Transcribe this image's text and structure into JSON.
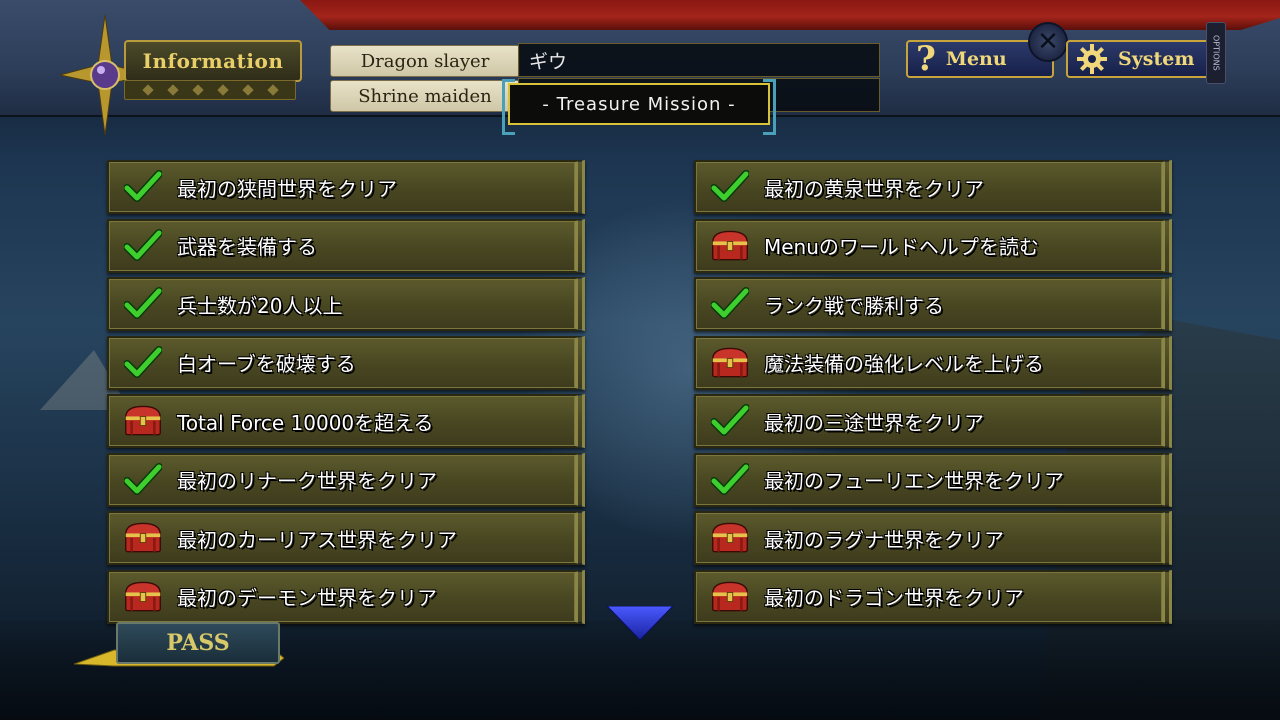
{
  "header": {
    "info_label": "Information",
    "role1_label": "Dragon slayer",
    "role1_value": "ギウ",
    "role2_label": "Shrine maiden",
    "role2_value": "",
    "menu_label": "Menu",
    "system_label": "System",
    "options_label": "OPTIONS",
    "mission_title": "- Treasure Mission -"
  },
  "missions_left": [
    {
      "label": "最初の狭間世界をクリア",
      "status": "done",
      "icon": "checkmark-icon"
    },
    {
      "label": "武器を装備する",
      "status": "done",
      "icon": "checkmark-icon"
    },
    {
      "label": "兵士数が20人以上",
      "status": "done",
      "icon": "checkmark-icon"
    },
    {
      "label": "白オーブを破壊する",
      "status": "done",
      "icon": "checkmark-icon"
    },
    {
      "label": "Total Force 10000を超える",
      "status": "pending",
      "icon": "treasure-chest-icon"
    },
    {
      "label": "最初のリナーク世界をクリア",
      "status": "done",
      "icon": "checkmark-icon"
    },
    {
      "label": "最初のカーリアス世界をクリア",
      "status": "pending",
      "icon": "treasure-chest-icon"
    },
    {
      "label": "最初のデーモン世界をクリア",
      "status": "pending",
      "icon": "treasure-chest-icon"
    }
  ],
  "missions_right": [
    {
      "label": "最初の黄泉世界をクリア",
      "status": "done",
      "icon": "checkmark-icon"
    },
    {
      "label": "Menuのワールドヘルプを読む",
      "status": "pending",
      "icon": "treasure-chest-icon"
    },
    {
      "label": "ランク戦で勝利する",
      "status": "done",
      "icon": "checkmark-icon"
    },
    {
      "label": "魔法装備の強化レベルを上げる",
      "status": "pending",
      "icon": "treasure-chest-icon"
    },
    {
      "label": "最初の三途世界をクリア",
      "status": "done",
      "icon": "checkmark-icon"
    },
    {
      "label": "最初のフューリエン世界をクリア",
      "status": "done",
      "icon": "checkmark-icon"
    },
    {
      "label": "最初のラグナ世界をクリア",
      "status": "pending",
      "icon": "treasure-chest-icon"
    },
    {
      "label": "最初のドラゴン世界をクリア",
      "status": "pending",
      "icon": "treasure-chest-icon"
    }
  ],
  "pass_label": "PASS",
  "colors": {
    "check": "#3ecf2e",
    "chest": "#b8281e",
    "row_bg": "#4a4822",
    "gold": "#d8c23a"
  }
}
